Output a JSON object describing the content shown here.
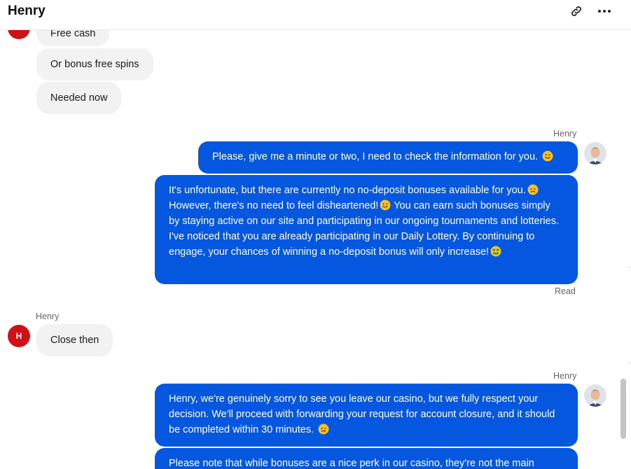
{
  "header": {
    "title": "Henry",
    "link_icon": "link-icon",
    "more_icon": "more-horizontal-icon"
  },
  "messages": {
    "in_1": "Free cash",
    "in_2": "Or bonus free spins",
    "in_3": "Needed now",
    "out_1_sender": "Henry",
    "out_1a": "Please, give me a minute or two, I need to check the information for you.",
    "out_1b": "It's unfortunate, but there are currently no no-deposit bonuses available for you.",
    "out_1b_2": "However, there's no need to feel disheartened!",
    "out_1b_3": "You can earn such bonuses simply by staying active on our site and participating in our ongoing tournaments and lotteries. I've noticed that you are already participating in our Daily Lottery. By continuing to engage, your chances of winning a no-deposit bonus will only increase!",
    "read_status": "Read",
    "in_sender": "Henry",
    "in_avatar_initial": "H",
    "in_4": "Close then",
    "out_2_sender": "Henry",
    "out_2a": "Henry, we're genuinely sorry to see you leave our casino, but we fully respect your decision. We'll proceed with forwarding your request for account closure, and it should be completed within 30 minutes.",
    "out_2b": "Please note that while bonuses are a nice perk in our casino, they're not the main"
  },
  "colors": {
    "outgoing_bubble": "#0557e0",
    "incoming_bubble": "#f2f2f2",
    "user_avatar": "#d00f16"
  }
}
